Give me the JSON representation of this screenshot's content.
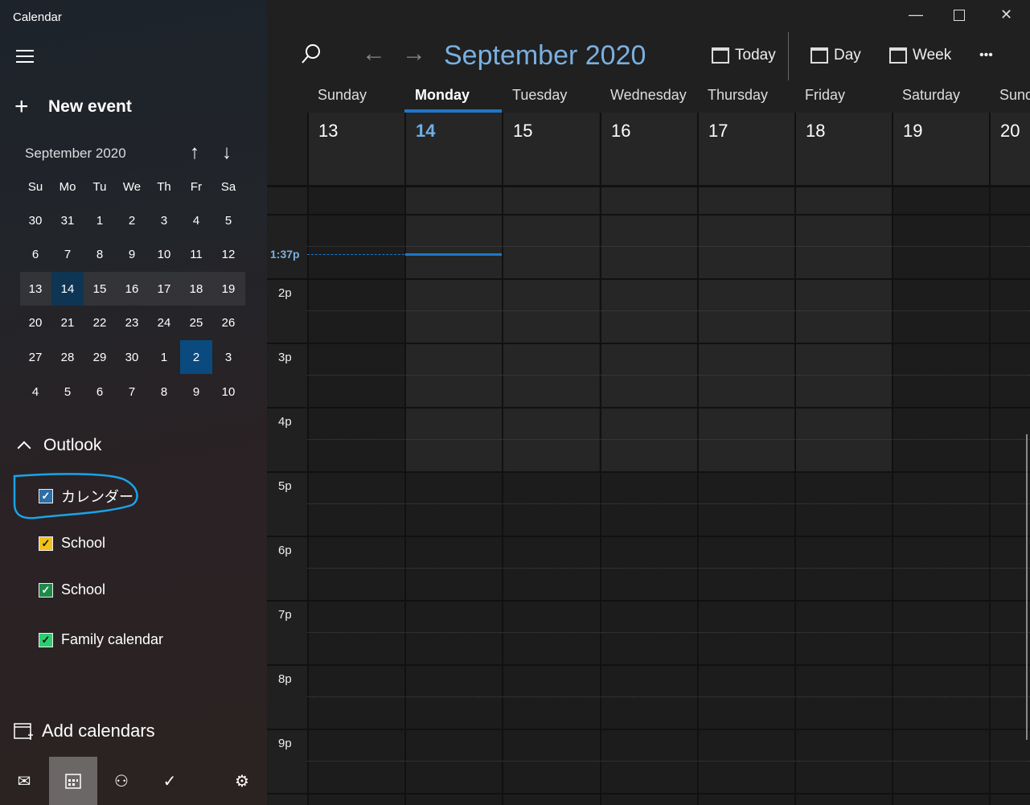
{
  "app_title": "Calendar",
  "sidebar": {
    "new_event": "New event",
    "mini_calendar": {
      "month": "September 2020",
      "weekdays": [
        "Su",
        "Mo",
        "Tu",
        "We",
        "Th",
        "Fr",
        "Sa"
      ],
      "weeks": [
        [
          "30",
          "31",
          "1",
          "2",
          "3",
          "4",
          "5"
        ],
        [
          "6",
          "7",
          "8",
          "9",
          "10",
          "11",
          "12"
        ],
        [
          "13",
          "14",
          "15",
          "16",
          "17",
          "18",
          "19"
        ],
        [
          "20",
          "21",
          "22",
          "23",
          "24",
          "25",
          "26"
        ],
        [
          "27",
          "28",
          "29",
          "30",
          "1",
          "2",
          "3"
        ],
        [
          "4",
          "5",
          "6",
          "7",
          "8",
          "9",
          "10"
        ]
      ],
      "today": "14",
      "selected": "2"
    },
    "group": "Outlook",
    "calendars": [
      {
        "label": "カレンダー",
        "color": "#2d6fa8",
        "checked": true
      },
      {
        "label": "School",
        "color": "#f2c21b",
        "checked": true
      },
      {
        "label": "School",
        "color": "#1e8a4a",
        "checked": true
      },
      {
        "label": "Family calendar",
        "color": "#2ecc71",
        "checked": true
      }
    ],
    "add_calendars": "Add calendars"
  },
  "toolbar": {
    "month_title": "September 2020",
    "today": "Today",
    "day": "Day",
    "week": "Week",
    "more": "•••"
  },
  "week": {
    "days": [
      {
        "name": "Sunday",
        "date": "13"
      },
      {
        "name": "Monday",
        "date": "14"
      },
      {
        "name": "Tuesday",
        "date": "15"
      },
      {
        "name": "Wednesday",
        "date": "16"
      },
      {
        "name": "Thursday",
        "date": "17"
      },
      {
        "name": "Friday",
        "date": "18"
      },
      {
        "name": "Saturday",
        "date": "19"
      },
      {
        "name": "Sunday",
        "date": "20"
      }
    ],
    "current_day_index": 1,
    "current_time": "1:37p",
    "hours": [
      "",
      "2p",
      "3p",
      "4p",
      "5p",
      "6p",
      "7p",
      "8p",
      "9p"
    ]
  },
  "colors": {
    "accent": "#1f77c9",
    "annotation": "#1aa3e8"
  }
}
